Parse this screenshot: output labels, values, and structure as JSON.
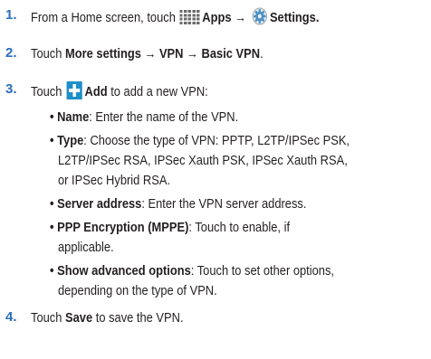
{
  "steps": [
    {
      "number": "1.",
      "prefix": "From a Home screen, touch",
      "apps_label": "Apps",
      "arrow": "→",
      "settings_label": "Settings",
      "suffix": "."
    },
    {
      "number": "2.",
      "prefix": "Touch",
      "path": "More settings → VPN → Basic VPN",
      "suffix": "."
    },
    {
      "number": "3.",
      "prefix": "Touch",
      "add_label": "Add",
      "suffix": "to add a new VPN:"
    },
    {
      "number": "4.",
      "prefix": "Touch",
      "save_label": "Save",
      "suffix": "to save the VPN."
    }
  ],
  "bullets": [
    {
      "label": "Name",
      "lines": [
        ": Enter the name of the VPN."
      ]
    },
    {
      "label": "Type",
      "lines": [
        ": Choose the type of VPN: PPTP, L2TP/IPSec PSK,",
        "L2TP/IPSec RSA, IPSec Xauth PSK, IPSec Xauth RSA,",
        "or IPSec Hybrid RSA."
      ]
    },
    {
      "label": "Server address",
      "lines": [
        ": Enter the VPN server address."
      ]
    },
    {
      "label": "PPP Encryption (MPPE)",
      "lines": [
        ": Touch to enable, if",
        "applicable."
      ]
    },
    {
      "label": "Show advanced options",
      "lines": [
        ": Touch to set other options,",
        "depending on the type of VPN."
      ]
    }
  ],
  "icons": {
    "apps": "apps-grid-icon",
    "settings": "gear-icon",
    "add": "plus-icon"
  },
  "colors": {
    "step_number": "#2a6ebb",
    "text": "#231f20",
    "add_icon": "#1e8ec9"
  }
}
